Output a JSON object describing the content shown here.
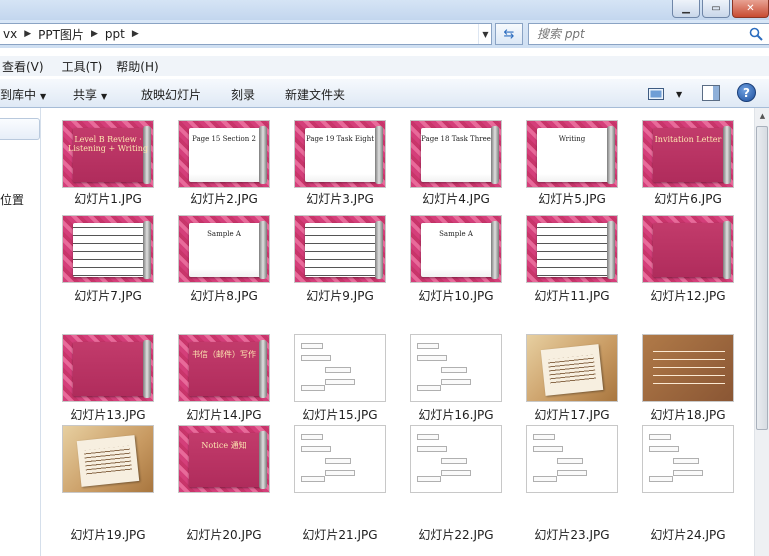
{
  "breadcrumb": [
    "vx",
    "PPT图片",
    "ppt"
  ],
  "search": {
    "placeholder": "搜索 ppt"
  },
  "menu": [
    "查看(V)",
    "工具(T)",
    "帮助(H)"
  ],
  "commands": {
    "library": "到库中",
    "share": "共享",
    "slideshow": "放映幻灯片",
    "burn": "刻录",
    "new_folder": "新建文件夹"
  },
  "nav": {
    "partial_label": "位置"
  },
  "files": [
    {
      "name": "幻灯片1.JPG",
      "style": "pink-dark",
      "text": "Level B Review · Listening + Writing"
    },
    {
      "name": "幻灯片2.JPG",
      "style": "pink",
      "text": "Page 15 Section 2"
    },
    {
      "name": "幻灯片3.JPG",
      "style": "pink",
      "text": "Page 19 Task Eight"
    },
    {
      "name": "幻灯片4.JPG",
      "style": "pink",
      "text": "Page 18 Task Three"
    },
    {
      "name": "幻灯片5.JPG",
      "style": "pink",
      "text": "Writing"
    },
    {
      "name": "幻灯片6.JPG",
      "style": "pink-dark",
      "text": "Invitation Letter"
    },
    {
      "name": "幻灯片7.JPG",
      "style": "pink-lines",
      "text": ""
    },
    {
      "name": "幻灯片8.JPG",
      "style": "pink",
      "text": "Sample A"
    },
    {
      "name": "幻灯片9.JPG",
      "style": "pink-lines",
      "text": ""
    },
    {
      "name": "幻灯片10.JPG",
      "style": "pink",
      "text": "Sample A"
    },
    {
      "name": "幻灯片11.JPG",
      "style": "pink-lines",
      "text": ""
    },
    {
      "name": "幻灯片12.JPG",
      "style": "pink-dark",
      "text": ""
    },
    {
      "name": "幻灯片13.JPG",
      "style": "pink-dark",
      "text": ""
    },
    {
      "name": "幻灯片14.JPG",
      "style": "pink-dark",
      "text": "书信（邮件）写作"
    },
    {
      "name": "幻灯片15.JPG",
      "style": "white",
      "text": ""
    },
    {
      "name": "幻灯片16.JPG",
      "style": "white",
      "text": ""
    },
    {
      "name": "幻灯片17.JPG",
      "style": "paper",
      "text": ""
    },
    {
      "name": "幻灯片18.JPG",
      "style": "brown",
      "text": ""
    },
    {
      "name": "幻灯片19.JPG",
      "style": "paper",
      "text": ""
    },
    {
      "name": "幻灯片20.JPG",
      "style": "pink-dark",
      "text": "Notice 通知"
    },
    {
      "name": "幻灯片21.JPG",
      "style": "white",
      "text": ""
    },
    {
      "name": "幻灯片22.JPG",
      "style": "white",
      "text": ""
    },
    {
      "name": "幻灯片23.JPG",
      "style": "white",
      "text": ""
    },
    {
      "name": "幻灯片24.JPG",
      "style": "white",
      "text": ""
    }
  ]
}
